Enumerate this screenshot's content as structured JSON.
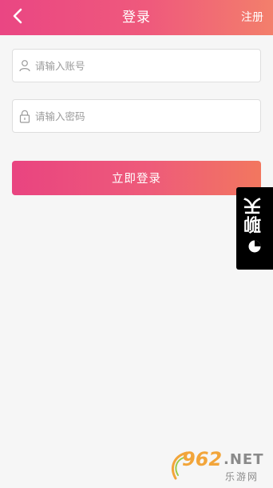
{
  "header": {
    "back_icon": "chevron-left-icon",
    "title": "登录",
    "register_label": "注册",
    "gradient_start": "#ea4683",
    "gradient_end": "#f37f6b"
  },
  "form": {
    "account": {
      "placeholder": "请输入账号",
      "value": "",
      "icon": "user-icon"
    },
    "password": {
      "placeholder": "请输入密码",
      "value": "",
      "icon": "lock-icon"
    },
    "submit_label": "立即登录"
  },
  "side_tab": {
    "label": "聊天",
    "icon": "chat-bubble-icon",
    "background": "#000000"
  },
  "watermark": {
    "number": "962",
    "domain": ".NET",
    "sub": "乐游网"
  }
}
